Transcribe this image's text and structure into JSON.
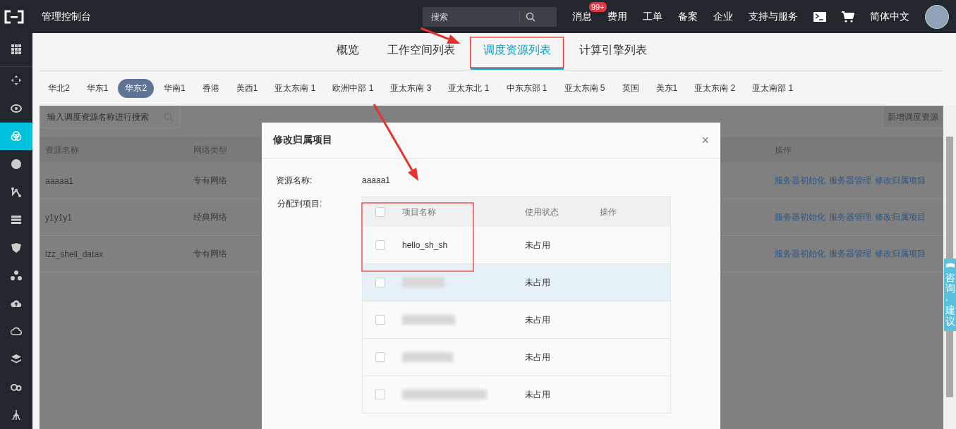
{
  "topbar": {
    "title": "管理控制台",
    "search": {
      "placeholder": "搜索"
    },
    "nav": [
      {
        "kind": "text",
        "label": "消息",
        "badge": "99+"
      },
      {
        "kind": "text",
        "label": "费用"
      },
      {
        "kind": "text",
        "label": "工单"
      },
      {
        "kind": "text",
        "label": "备案"
      },
      {
        "kind": "text",
        "label": "企业"
      },
      {
        "kind": "text",
        "label": "支持与服务"
      },
      {
        "kind": "terminal"
      },
      {
        "kind": "cart"
      },
      {
        "kind": "text",
        "label": "简体中文"
      },
      {
        "kind": "avatar"
      }
    ]
  },
  "sidebar": {
    "items": [
      {
        "selected": false
      },
      {
        "selected": false
      },
      {
        "selected": false
      },
      {
        "selected": true
      },
      {
        "selected": false
      },
      {
        "selected": false
      },
      {
        "selected": false
      },
      {
        "selected": false
      },
      {
        "selected": false
      },
      {
        "selected": false
      },
      {
        "selected": false
      },
      {
        "selected": false
      },
      {
        "selected": false
      },
      {
        "selected": false
      }
    ]
  },
  "tabs": [
    {
      "label": "概览",
      "selected": false
    },
    {
      "label": "工作空间列表",
      "selected": false
    },
    {
      "label": "调度资源列表",
      "selected": true
    },
    {
      "label": "计算引擎列表",
      "selected": false
    }
  ],
  "regions": [
    {
      "label": "华北2",
      "selected": false
    },
    {
      "label": "华东1",
      "selected": false
    },
    {
      "label": "华东2",
      "selected": true
    },
    {
      "label": "华南1",
      "selected": false
    },
    {
      "label": "香港",
      "selected": false
    },
    {
      "label": "美西1",
      "selected": false
    },
    {
      "label": "亚太东南 1",
      "selected": false
    },
    {
      "label": "欧洲中部 1",
      "selected": false
    },
    {
      "label": "亚太东南 3",
      "selected": false
    },
    {
      "label": "亚太东北 1",
      "selected": false
    },
    {
      "label": "中东东部 1",
      "selected": false
    },
    {
      "label": "亚太东南 5",
      "selected": false
    },
    {
      "label": "英国",
      "selected": false
    },
    {
      "label": "美东1",
      "selected": false
    },
    {
      "label": "亚太东南 2",
      "selected": false
    },
    {
      "label": "亚太南部 1",
      "selected": false
    }
  ],
  "list": {
    "search": {
      "placeholder": "输入调度资源名称进行搜索"
    },
    "add_button": "新增调度资源",
    "columns": [
      "资源名称",
      "网络类型",
      "操作"
    ],
    "rows": [
      {
        "name": "aaaaa1",
        "network": "专有网络",
        "actions": [
          "服务器初始化",
          "服务器管理",
          "修改归属项目"
        ]
      },
      {
        "name": "y1y1y1",
        "network": "经典网络",
        "actions": [
          "服务器初始化",
          "服务器管理",
          "修改归属项目"
        ]
      },
      {
        "name": "lzz_shell_datax",
        "network": "专有网络",
        "actions": [
          "服务器初始化",
          "服务器管理",
          "修改归属项目"
        ]
      }
    ]
  },
  "dialog": {
    "title": "修改归属项目",
    "close": "×",
    "resource_label": "资源名称:",
    "resource_value": "aaaaa1",
    "assign_label": "分配到项目:",
    "table": {
      "header_checked": false,
      "columns": [
        "项目名称",
        "使用状态",
        "操作"
      ],
      "rows": [
        {
          "name": "hello_sh_sh",
          "status": "未占用",
          "checked": false,
          "hovered": false,
          "redacted": false
        },
        {
          "status": "未占用",
          "checked": false,
          "hovered": true,
          "redacted": true
        },
        {
          "status": "未占用",
          "checked": false,
          "hovered": false,
          "redacted": true
        },
        {
          "status": "未占用",
          "checked": false,
          "hovered": false,
          "redacted": true
        },
        {
          "status": "未占用",
          "checked": false,
          "hovered": false,
          "redacted": true
        }
      ]
    }
  },
  "feedback_tab": "咨询·建议",
  "annotations": [
    {
      "kind": "arrow"
    },
    {
      "kind": "frame"
    },
    {
      "kind": "arrow"
    },
    {
      "kind": "frame"
    }
  ]
}
